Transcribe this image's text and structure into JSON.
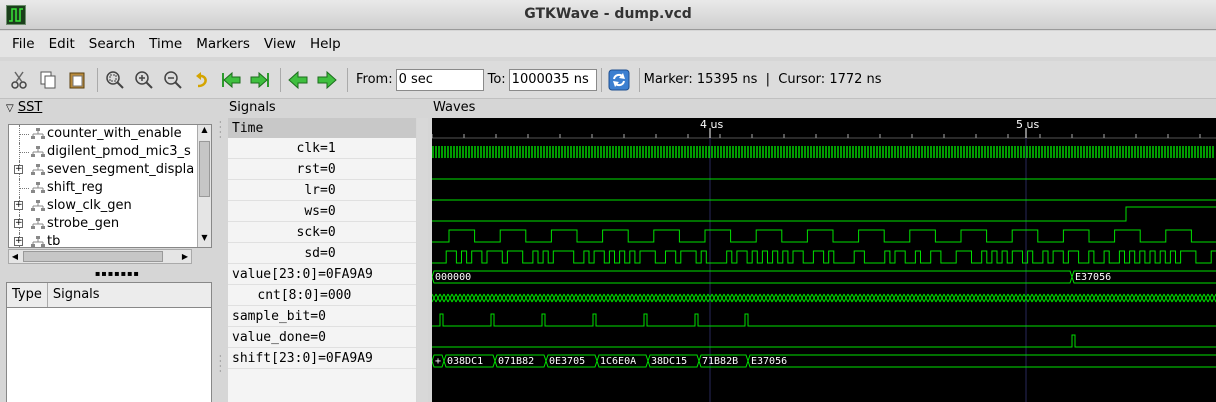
{
  "window": {
    "title": "GTKWave - dump.vcd"
  },
  "menu": [
    "File",
    "Edit",
    "Search",
    "Time",
    "Markers",
    "View",
    "Help"
  ],
  "toolbar": {
    "from_label": "From:",
    "from_value": "0 sec",
    "to_label": "To:",
    "to_value": "1000035 ns",
    "marker_text": "Marker: 15395 ns  |  Cursor: 1772 ns"
  },
  "sst": {
    "title": "SST",
    "tree": [
      {
        "label": "counter_with_enable",
        "expandable": false
      },
      {
        "label": "digilent_pmod_mic3_s",
        "expandable": false
      },
      {
        "label": "seven_segment_displa",
        "expandable": true
      },
      {
        "label": "shift_reg",
        "expandable": false
      },
      {
        "label": "slow_clk_gen",
        "expandable": true
      },
      {
        "label": "strobe_gen",
        "expandable": true
      },
      {
        "label": "tb",
        "expandable": true
      }
    ],
    "list_headers": [
      "Type",
      "Signals"
    ]
  },
  "signals": {
    "title": "Signals",
    "time_header": "Time",
    "rows": [
      {
        "name": "clk",
        "value": "=1"
      },
      {
        "name": "rst",
        "value": "=0"
      },
      {
        "name": "lr",
        "value": "=0"
      },
      {
        "name": "ws",
        "value": "=0"
      },
      {
        "name": "sck",
        "value": "=0"
      },
      {
        "name": "sd",
        "value": "=0"
      },
      {
        "name": "value[23:0]",
        "value": "=0FA9A9"
      },
      {
        "name": "cnt[8:0]",
        "value": "=000"
      },
      {
        "name": "sample_bit",
        "value": "=0"
      },
      {
        "name": "value_done",
        "value": "=0"
      },
      {
        "name": "shift[23:0]",
        "value": "=0FA9A9"
      }
    ]
  },
  "waves": {
    "title": "Waves",
    "time_labels": [
      "4 us",
      "5 us"
    ],
    "value_labels": [
      "000000",
      "E37056"
    ],
    "shift_labels": [
      "+",
      "038DC1",
      "071B82",
      "0E3705",
      "1C6E0A",
      "38DC15",
      "71B82B",
      "E37056"
    ],
    "colors": {
      "wave": "#00e000",
      "marker": "#3c3cff",
      "bg": "#000000",
      "grid": "#ffffff"
    }
  }
}
